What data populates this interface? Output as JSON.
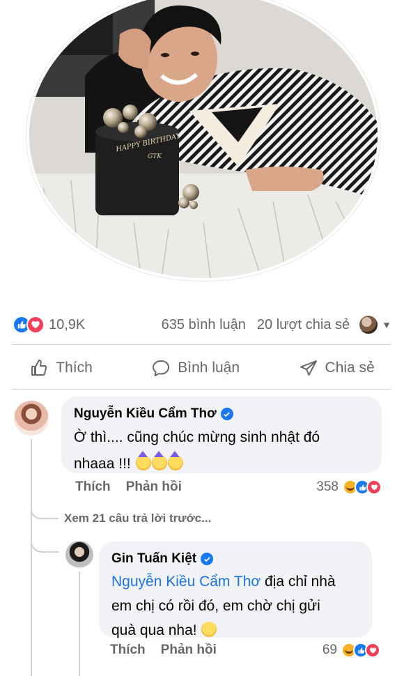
{
  "post": {
    "reaction_count": "10,9K",
    "comment_count": "635 bình luận",
    "share_count": "20 lượt chia sẻ"
  },
  "actions": {
    "like": "Thích",
    "comment": "Bình luận",
    "share": "Chia sẻ"
  },
  "comments": [
    {
      "author": "Nguyễn Kiều Cẩm Thơ",
      "text_line1": "Ờ thì.... cũng chúc mừng sinh nhật đó",
      "text_line2": "nhaaa  !!!",
      "like_label": "Thích",
      "reply_label": "Phản hồi",
      "reaction_count": "358"
    }
  ],
  "view_previous": "Xem 21 câu trả lời trước...",
  "reply": {
    "author": "Gin Tuấn Kiệt",
    "mention": "Nguyễn Kiều Cẩm Thơ",
    "text_after_mention": " địa chỉ nhà",
    "text_line2": "em chị có rồi đó, em chờ chị gửi",
    "text_line3": "quà qua nha!",
    "like_label": "Thích",
    "reply_label": "Phản hồi",
    "reaction_count": "69"
  },
  "cake_text": "HAPPY BIRTHDAY GTK",
  "colors": {
    "like_blue": "#1877f2",
    "love_red": "#f33e58",
    "haha_yellow": "#f7b125",
    "mention_blue": "#1b74e4",
    "meta_gray": "#65676b",
    "bubble_bg": "#f0f2f5"
  },
  "icons": [
    "like-reaction-icon",
    "love-reaction-icon",
    "haha-reaction-icon",
    "thumbs-up-icon",
    "comment-icon",
    "share-icon",
    "verified-badge-icon",
    "chevron-down-icon"
  ]
}
